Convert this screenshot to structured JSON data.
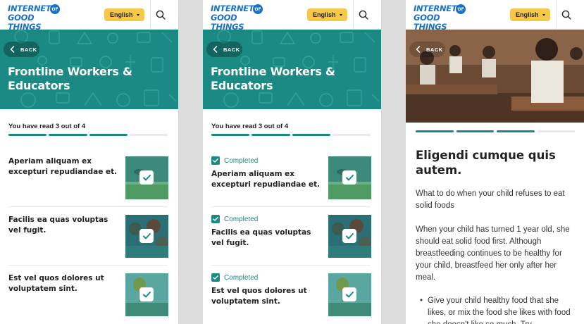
{
  "brand": {
    "line1": "INTERNET",
    "of": "OF",
    "line2": "GOOD THINGS"
  },
  "header": {
    "language": "English"
  },
  "hero": {
    "back_label": "BACK",
    "title": "Frontline Workers & Educators"
  },
  "list": {
    "progress_label": "You have read 3 out of 4",
    "progress": {
      "read": 3,
      "total": 4
    },
    "completed_label": "Completed",
    "items": [
      {
        "title": "Aperiam aliquam ex excepturi repudiandae et."
      },
      {
        "title": "Facilis ea quas voluptas vel fugit."
      },
      {
        "title": "Est vel quos dolores ut voluptatem sint."
      }
    ]
  },
  "article": {
    "back_label": "BACK",
    "progress": {
      "read": 3,
      "total": 4
    },
    "title": "Eligendi cumque quis autem.",
    "intro": "What to do when your child refuses to eat solid foods",
    "body": "When your child has turned 1 year old, she should eat solid food first. Although breastfeeding continues to be healthy for your child, breastfeed her only after her meal.",
    "bullet": "Give your child healthy food that she likes, or mix the food she likes with food she doesn't like so much. Try"
  },
  "colors": {
    "teal": "#1b8a84",
    "brand_blue": "#1b73c5",
    "language_yellow": "#f5c84b"
  }
}
